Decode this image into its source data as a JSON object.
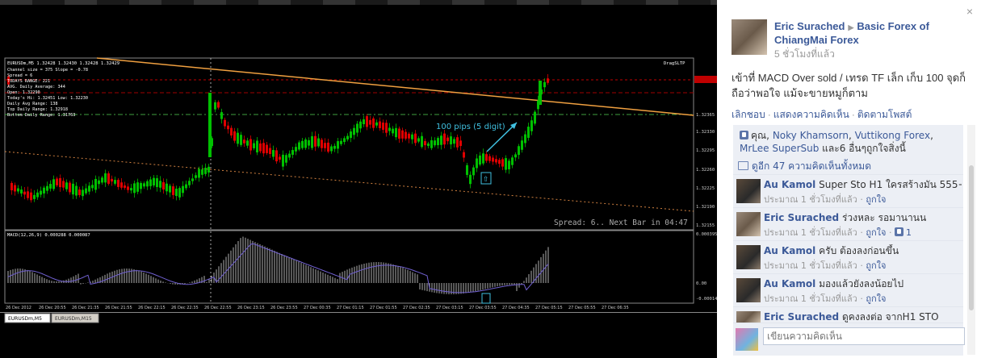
{
  "chart": {
    "header_info": "EURUSDm,M5  1.32428 1.32430 1.32428 1.32429",
    "info_lines": [
      "Channel size = 375  Slope = -0.78",
      "Spread = 6",
      "TODAYS RANGE: 221",
      "AVG. Daily Average: 344",
      "Open: 1.32290",
      "Today's Hi: 1.32451  Low: 1.32230",
      "Daily Avg Range: 138",
      "Top Daily Range: 1.32918",
      "Bottom Daily Range: 1.31763"
    ],
    "indicator_label": "DragSLTP",
    "annotation": "100 pips (5 digit)",
    "spread_footer": "Spread: 6.. Next Bar in 04:47",
    "price_ticks": [
      "1.32429",
      "1.32365",
      "1.32330",
      "1.32295",
      "1.32260",
      "1.32225",
      "1.32190",
      "1.32155"
    ],
    "macd_label": "MACD(12,26,9) 0.000288 0.000087",
    "macd_ticks": [
      "0.000395",
      "0.00",
      "-0.00014"
    ],
    "time_ticks": [
      "26 Dec 2012",
      "26 Dec 20:55",
      "26 Dec 21:35",
      "26 Dec 21:55",
      "26 Dec 22:15",
      "26 Dec 22:35",
      "26 Dec 22:55",
      "26 Dec 23:15",
      "26 Dec 23:55",
      "27 Dec 00:35",
      "27 Dec 01:15",
      "27 Dec 01:55",
      "27 Dec 02:35",
      "27 Dec 03:15",
      "27 Dec 03:55",
      "27 Dec 04:35",
      "27 Dec 05:15",
      "27 Dec 05:55",
      "27 Dec 06:35"
    ],
    "tabs": [
      "EURUSDm,M5",
      "EURUSDm,M15"
    ],
    "colors": {
      "up": "#00c000",
      "down": "#e00000",
      "trend": "#f0a040",
      "ask": "#c00000",
      "bid": "#40a040",
      "annotation": "#40c0e0",
      "macd_signal": "#7060d0"
    }
  },
  "panel": {
    "close_glyph": "×",
    "author": "Eric Surached",
    "group": "Basic Forex of ChiangMai Forex",
    "time": "5 ชั่วโมงที่แล้ว",
    "message": "เข้าที่ MACD Over sold / เทรด TF เล็ก เก็บ 100 จุดก็ถือว่าพอใจ แม้จะขายหมูก็ตาม",
    "actions": [
      "เลิกชอบ",
      "แสดงความคิดเห็น",
      "ติดตามโพสต์"
    ],
    "likes": {
      "prefix": "คุณ,",
      "names": [
        "Noky Khamsorn",
        "Vuttikong Forex",
        "MrLee SuperSub"
      ],
      "suffix": "และ6 อื่นๆถูกใจสิ่งนี้"
    },
    "more_comments": "ดูอีก 47 ความคิดเห็นทั้งหมด",
    "comments": [
      {
        "name": "Au Kamol",
        "text": "Super Sto H1 ใครสร้างมัน 555+",
        "time": "ประมาณ 1 ชั่วโมงที่แล้ว",
        "like": "ถูกใจ",
        "count": ""
      },
      {
        "name": "Eric Surached",
        "text": "ร่วงหละ รอมานานน",
        "time": "ประมาณ 1 ชั่วโมงที่แล้ว",
        "like": "ถูกใจ",
        "count": "1"
      },
      {
        "name": "Au Kamol",
        "text": "ครับ ต้องลงก่อนขึ้น",
        "time": "ประมาณ 1 ชั่วโมงที่แล้ว",
        "like": "ถูกใจ",
        "count": ""
      },
      {
        "name": "Au Kamol",
        "text": "มองแล้วยังลงน้อยไป",
        "time": "ประมาณ 1 ชั่วโมงที่แล้ว",
        "like": "ถูกใจ",
        "count": ""
      },
      {
        "name": "Eric Surached",
        "text": "ดูคงลงต่อ จากH1 STO",
        "time": "",
        "like": "",
        "count": ""
      }
    ],
    "comment_placeholder": "เขียนความคิดเห็น"
  }
}
